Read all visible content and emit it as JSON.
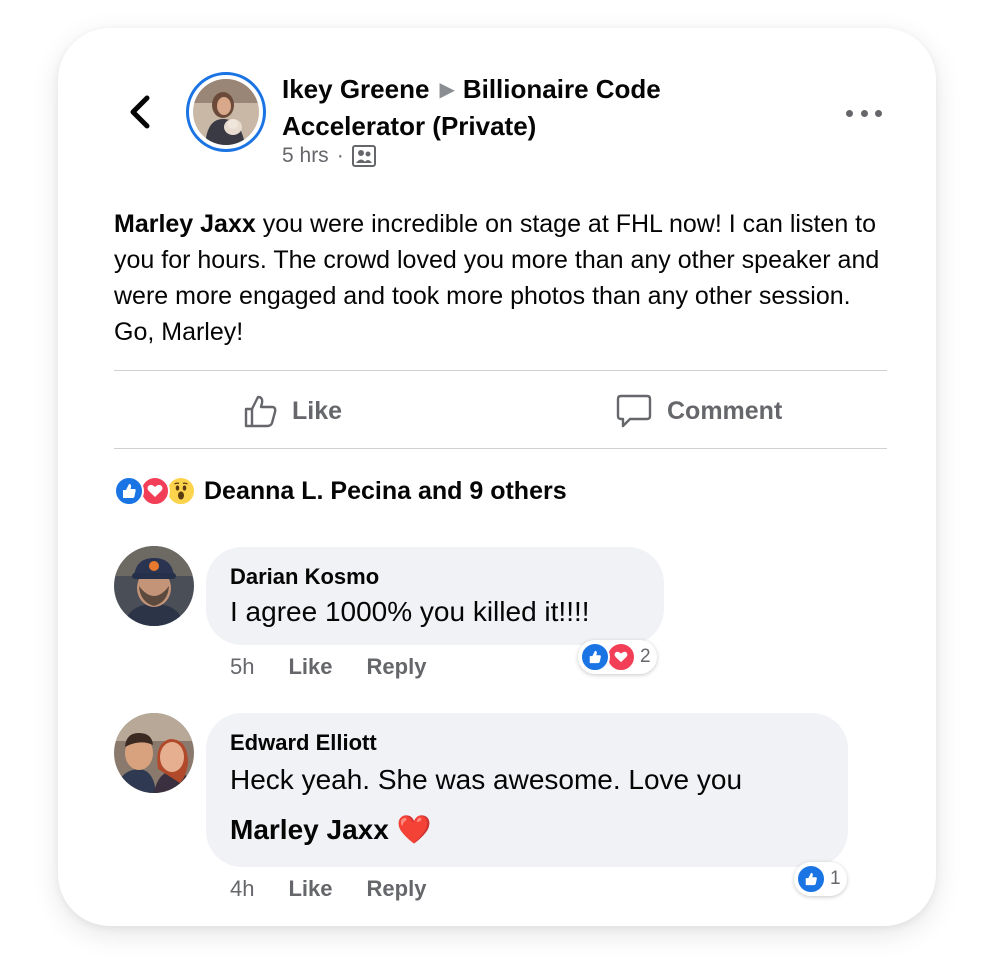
{
  "post": {
    "author": "Ikey Greene",
    "group": "Billionaire Code Accelerator (Private)",
    "time": "5 hrs",
    "time_separator": "·",
    "mention": "Marley Jaxx",
    "text": " you were incredible on stage at FHL now! I can listen to you for hours. The crowd loved you more than any other speaker and were more engaged and took more photos than any other session. Go, Marley!"
  },
  "actions": {
    "like_label": "Like",
    "comment_label": "Comment"
  },
  "reactions": {
    "icons": [
      "like-icon",
      "love-icon",
      "wow-icon"
    ],
    "summary": "Deanna L. Pecina and 9 others"
  },
  "comments": [
    {
      "name": "Darian Kosmo",
      "text": "I agree 1000% you killed it!!!!",
      "time": "5h",
      "like_label": "Like",
      "reply_label": "Reply",
      "reaction_icons": [
        "like-icon",
        "love-icon"
      ],
      "reaction_count": "2"
    },
    {
      "name": "Edward Elliott",
      "text_line1": "Heck yeah.  She was awesome.  Love you",
      "mention": "Marley Jaxx",
      "emoji": "❤️",
      "time": "4h",
      "like_label": "Like",
      "reply_label": "Reply",
      "reaction_icons": [
        "like-icon"
      ],
      "reaction_count": "1"
    }
  ],
  "colors": {
    "facebook_blue": "#1b74e4",
    "love_red": "#f33e58",
    "wow_yellow": "#fcd34d",
    "secondary_text": "#65676b",
    "bubble_bg": "#f0f2f5"
  }
}
